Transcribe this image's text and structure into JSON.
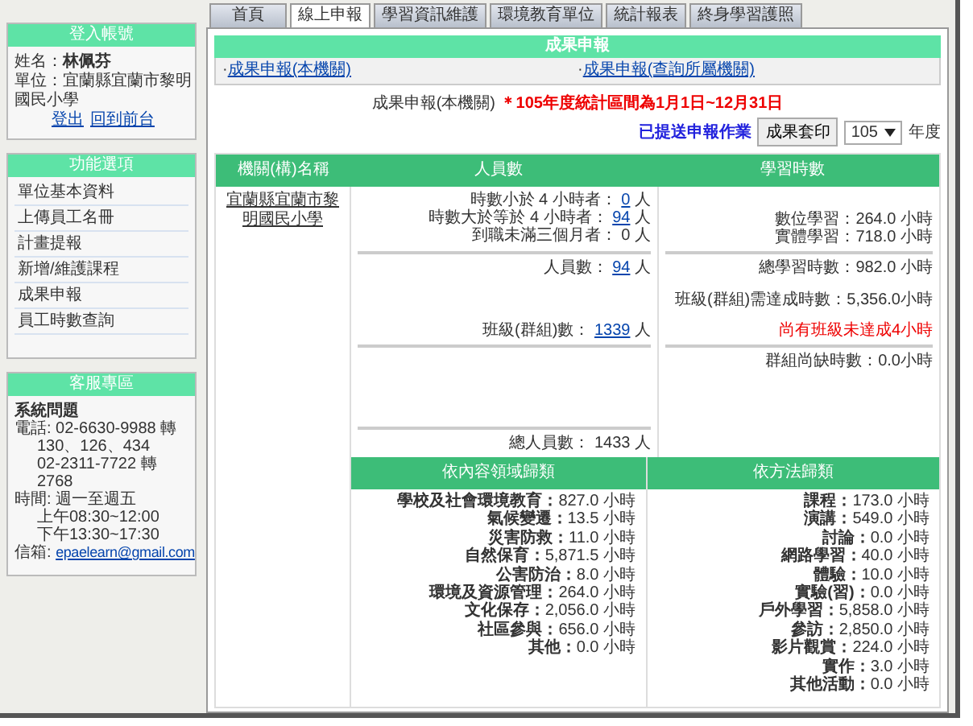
{
  "login": {
    "title": "登入帳號",
    "name": "姓名：**林佩芬**",
    "unit": "單位：宜蘭縣宜蘭市黎明國民小學",
    "links": [
      "登出",
      "回到前台"
    ]
  },
  "menu": {
    "title": "功能選項",
    "items": [
      "單位基本資料",
      "上傳員工名冊",
      "計畫提報",
      "新增/維護課程",
      "成果申報",
      "員工時數查詢"
    ]
  },
  "service": {
    "title": "客服專區",
    "lines": [
      {
        "kind": "heading",
        "text": "系統問題"
      },
      {
        "kind": "line",
        "text": "電話: 02-6630-9988 轉"
      },
      {
        "kind": "continuation",
        "text": "130、126、434"
      },
      {
        "kind": "continuation",
        "text": "02-2311-7722 轉"
      },
      {
        "kind": "continuation",
        "text": "2768"
      },
      {
        "kind": "line",
        "text": "時間: 週一至週五"
      },
      {
        "kind": "continuation",
        "text": "上午08:30~12:00"
      },
      {
        "kind": "continuation",
        "text": "下午13:30~17:30"
      }
    ],
    "email_label": "信箱: ",
    "email": "epaelearn@gmail.com"
  },
  "tabs": [
    {
      "label": "首頁",
      "selected": false
    },
    {
      "label": "線上申報",
      "selected": true
    },
    {
      "label": "學習資訊維護",
      "selected": false
    },
    {
      "label": "環境教育單位",
      "selected": false
    },
    {
      "label": "統計報表",
      "selected": false
    },
    {
      "label": "終身學習護照",
      "selected": false
    }
  ],
  "panel": {
    "title": "成果申報",
    "links": [
      {
        "bullet": "·",
        "label": "成果申報(本機關)"
      },
      {
        "bullet": "·",
        "label": "成果申報(查詢所屬機關)"
      }
    ]
  },
  "notice": {
    "text": "成果申報(本機關)",
    "note": "＊105年度統計區間為1月1日~12月31日"
  },
  "toolbar": {
    "submitted_link": "已提送申報作業",
    "print_button": "成果套印",
    "year": "105",
    "year_unit": "年度"
  },
  "table": {
    "columns": [
      "機關(構)名稱",
      "人員數",
      "學習時數"
    ],
    "org": "宜蘭縣宜蘭市黎明國民小學",
    "persons": [
      [
        {
          "label": "時數小於 4 小時者：",
          "value": "0",
          "unit": "人",
          "linked": true
        },
        {
          "label": "時數大於等於 4 小時者：",
          "value": "94",
          "unit": "人",
          "linked": true
        },
        {
          "label": "到職未滿三個月者：",
          "value": "0",
          "unit": "人",
          "linked": false
        }
      ],
      [
        {
          "label": "人員數：",
          "value": "94",
          "unit": "人",
          "linked": true
        },
        {
          "label": "班級(群組)數：",
          "value": "1339",
          "unit": "人",
          "linked": true
        }
      ],
      [
        {
          "label": "總人員數：",
          "value": "1433",
          "unit": "人",
          "linked": false
        }
      ]
    ],
    "hours": [
      [
        {
          "kind": "line",
          "text": "數位學習：264.0 小時"
        },
        {
          "kind": "line",
          "text": "實體學習：718.0 小時"
        }
      ],
      [
        {
          "kind": "line",
          "text": "總學習時數：982.0 小時"
        },
        {
          "kind": "line",
          "text": "班級(群組)需達成時數：5,356.0小時"
        },
        {
          "kind": "warning",
          "text": "尚有班級未達成4小時"
        }
      ],
      [
        {
          "kind": "line",
          "text": "群組尚缺時數：0.0小時"
        }
      ]
    ],
    "by_content": {
      "title": "依內容領域歸類",
      "rows": [
        {
          "label": "學校及社會環境教育：",
          "value": "827.0 小時"
        },
        {
          "label": "氣候變遷：",
          "value": "13.5 小時"
        },
        {
          "label": "災害防救：",
          "value": "11.0 小時"
        },
        {
          "label": "自然保育：",
          "value": "5,871.5 小時"
        },
        {
          "label": "公害防治：",
          "value": "8.0 小時"
        },
        {
          "label": "環境及資源管理：",
          "value": "264.0 小時"
        },
        {
          "label": "文化保存：",
          "value": "2,056.0 小時"
        },
        {
          "label": "社區參與：",
          "value": "656.0 小時"
        },
        {
          "label": "其他：",
          "value": "0.0 小時"
        }
      ]
    },
    "by_method": {
      "title": "依方法歸類",
      "rows": [
        {
          "label": "課程：",
          "value": "173.0 小時"
        },
        {
          "label": "演講：",
          "value": "549.0 小時"
        },
        {
          "label": "討論：",
          "value": "0.0 小時"
        },
        {
          "label": "網路學習：",
          "value": "40.0 小時"
        },
        {
          "label": "體驗：",
          "value": "10.0 小時"
        },
        {
          "label": "實驗(習)：",
          "value": "0.0 小時"
        },
        {
          "label": "戶外學習：",
          "value": "5,858.0 小時"
        },
        {
          "label": "參訪：",
          "value": "2,850.0 小時"
        },
        {
          "label": "影片觀賞：",
          "value": "224.0 小時"
        },
        {
          "label": "實作：",
          "value": "3.0 小時"
        },
        {
          "label": "其他活動：",
          "value": "0.0 小時"
        }
      ]
    }
  }
}
